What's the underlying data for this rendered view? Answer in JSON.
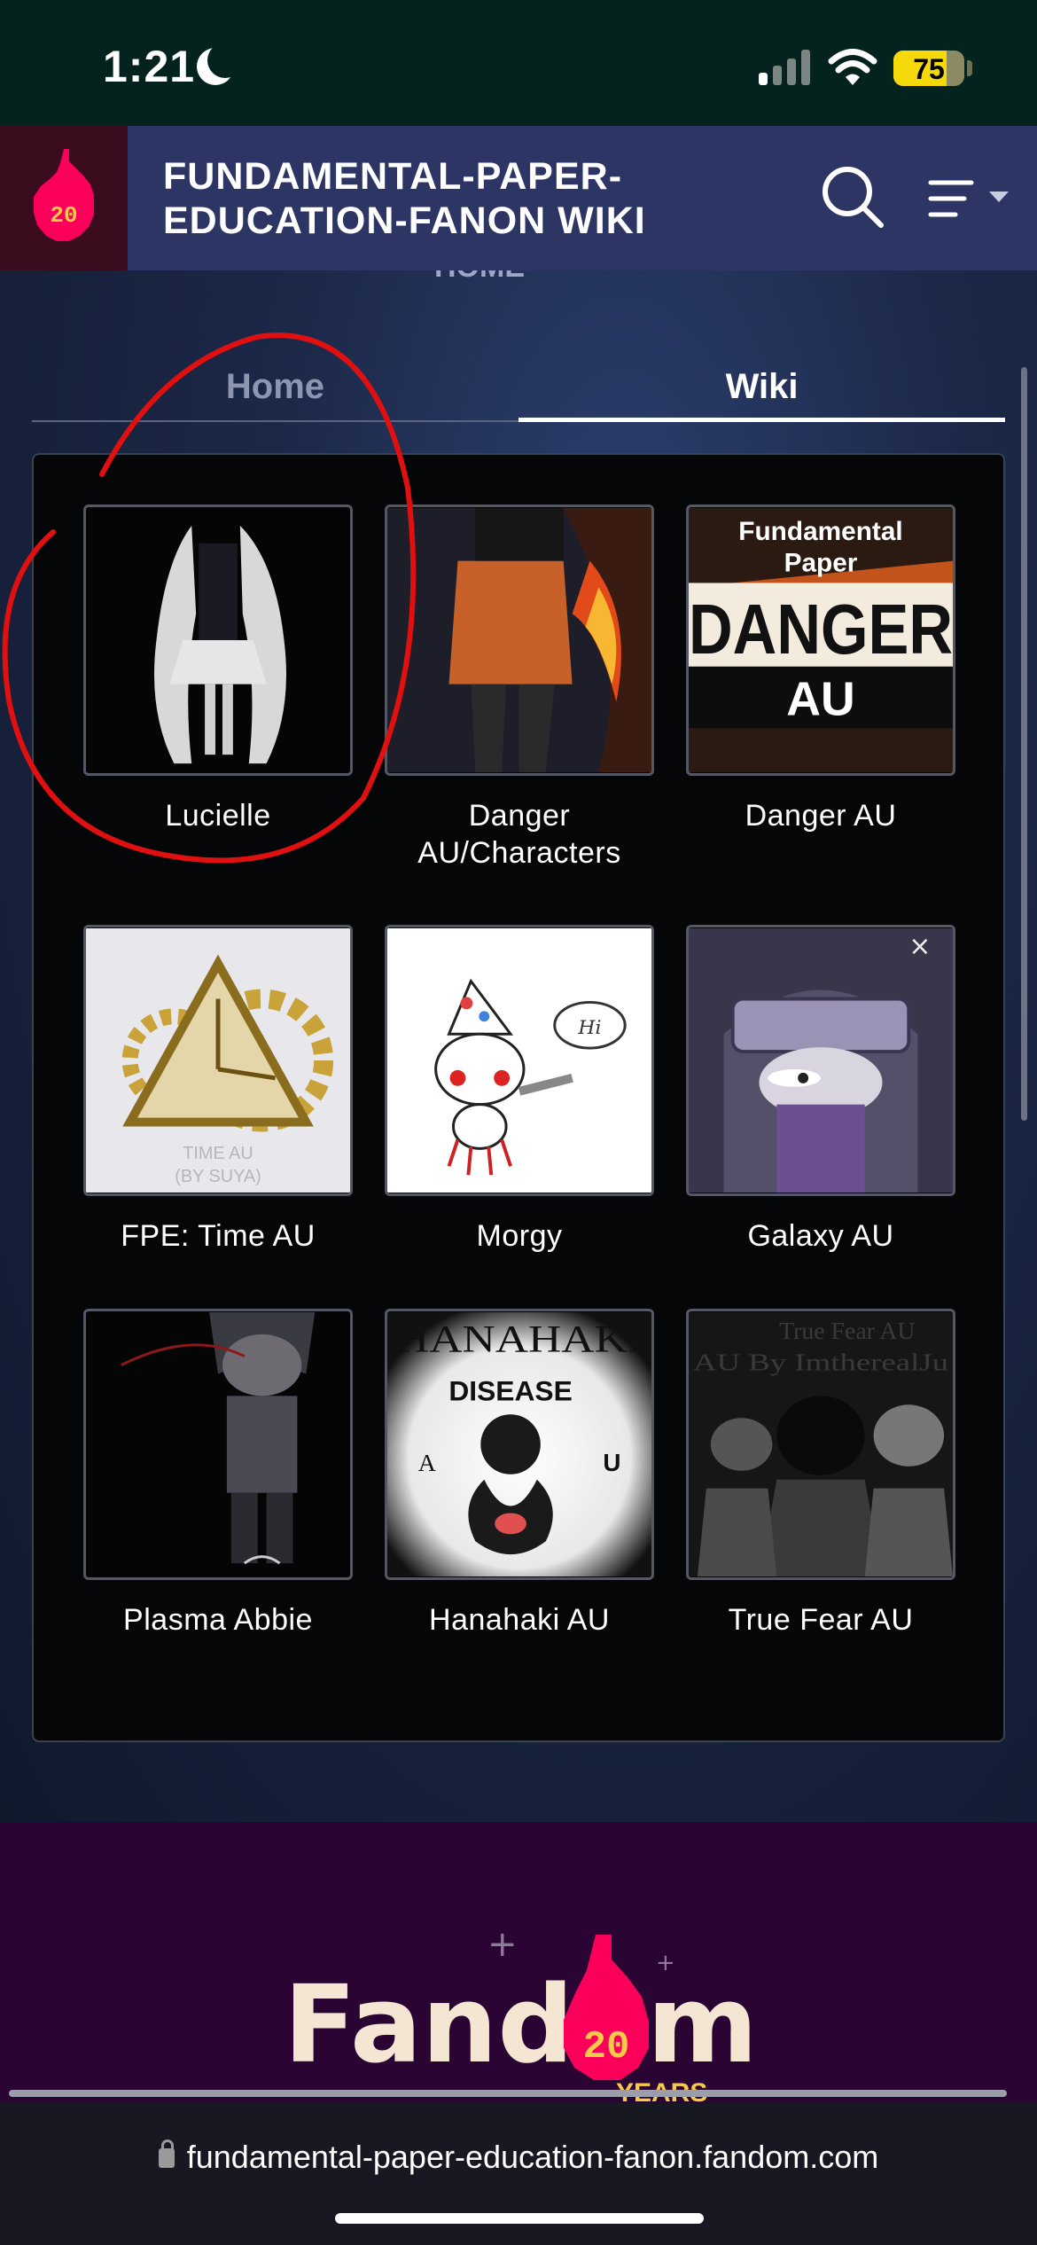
{
  "status_bar": {
    "time": "1:21",
    "battery": "75",
    "battery_level": 0.75
  },
  "header": {
    "site_title_line1": "FUNDAMENTAL-PAPER-",
    "site_title_line2": "EDUCATION-FANON WIKI",
    "logo_badge": "20"
  },
  "peek_text": "HOME",
  "tabs": [
    {
      "label": "Home",
      "active": false
    },
    {
      "label": "Wiki",
      "active": true
    }
  ],
  "gallery": [
    {
      "caption": "Lucielle"
    },
    {
      "caption": "Danger AU/Characters"
    },
    {
      "caption": "Danger AU",
      "image_text": [
        "Fundamental",
        "Paper",
        "DANGER",
        "AU"
      ]
    },
    {
      "caption": "FPE: Time AU",
      "image_text": [
        "TIME AU",
        "(BY SUYA)"
      ]
    },
    {
      "caption": "Morgy",
      "image_text": [
        "Hi"
      ]
    },
    {
      "caption": "Galaxy AU"
    },
    {
      "caption": "Plasma Abbie"
    },
    {
      "caption": "Hanahaki AU",
      "image_text": [
        "HANAHAKI",
        "DISEASE",
        "A",
        "U"
      ]
    },
    {
      "caption": "True Fear AU",
      "image_text": [
        "True Fear AU",
        "AU By ImtherealJu"
      ]
    }
  ],
  "footer": {
    "brand_left": "Fand",
    "brand_right": "m",
    "badge": "20",
    "years": "YEARS"
  },
  "url_bar": {
    "url": "fundamental-paper-education-fanon.fandom.com"
  },
  "colors": {
    "status_bg": "#04231f",
    "header_bg": "#2d3564",
    "footer_bg": "#2a0534",
    "annotation": "#e01010",
    "fandom_pink": "#fa005a"
  }
}
